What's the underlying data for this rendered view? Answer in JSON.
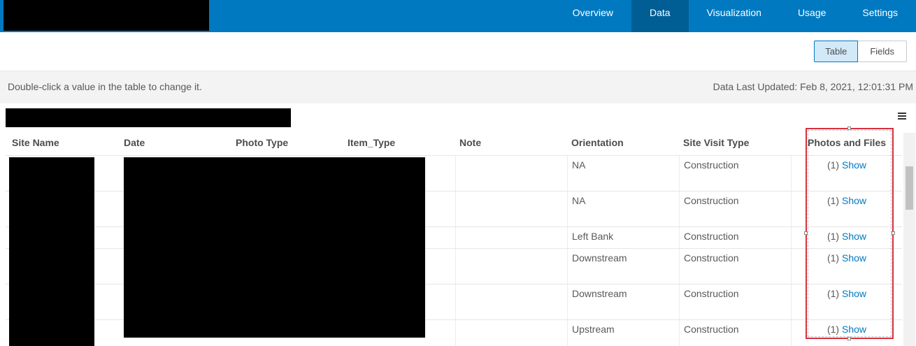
{
  "nav": {
    "items": [
      {
        "label": "Overview",
        "active": false
      },
      {
        "label": "Data",
        "active": true
      },
      {
        "label": "Visualization",
        "active": false
      },
      {
        "label": "Usage",
        "active": false
      },
      {
        "label": "Settings",
        "active": false
      }
    ]
  },
  "view_toggle": {
    "table_label": "Table",
    "fields_label": "Fields",
    "selected": "Table"
  },
  "info": {
    "hint": "Double-click a value in the table to change it.",
    "last_updated": "Data Last Updated: Feb 8, 2021, 12:01:31 PM"
  },
  "table": {
    "columns": [
      "Site Name",
      "Date",
      "Photo Type",
      "Item_Type",
      "Note",
      "Orientation",
      "Site Visit Type",
      "Photos and Files"
    ],
    "rows": [
      {
        "orientation": "NA",
        "visit_type": "Construction",
        "count": "(1)",
        "link": "Show"
      },
      {
        "orientation": "NA",
        "visit_type": "Construction",
        "count": "(1)",
        "link": "Show"
      },
      {
        "orientation": "Left Bank",
        "visit_type": "Construction",
        "count": "(1)",
        "link": "Show"
      },
      {
        "orientation": "Downstream",
        "visit_type": "Construction",
        "count": "(1)",
        "link": "Show"
      },
      {
        "orientation": "Downstream",
        "visit_type": "Construction",
        "count": "(1)",
        "link": "Show"
      },
      {
        "orientation": "Upstream",
        "visit_type": "Construction",
        "count": "(1)",
        "link": "Show"
      }
    ]
  },
  "colors": {
    "nav_bg": "#0079c1",
    "nav_active": "#005e95",
    "link": "#0079c1",
    "highlight": "#d6303c"
  }
}
